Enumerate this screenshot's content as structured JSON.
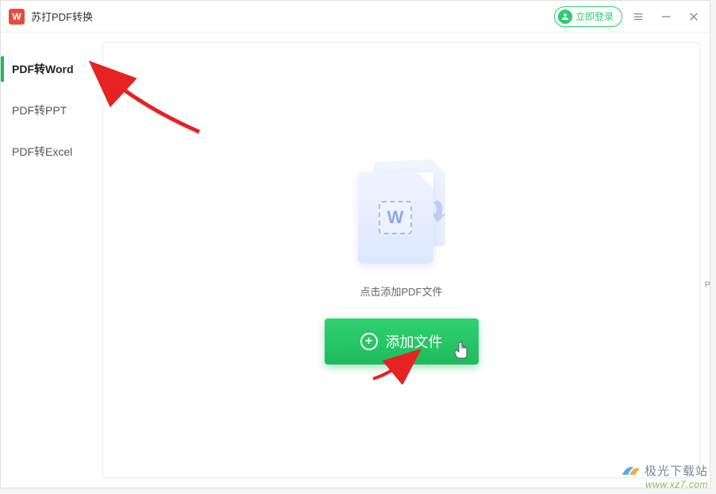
{
  "app": {
    "icon_letter": "W",
    "title": "苏打PDF转换"
  },
  "titlebar": {
    "login_label": "立即登录"
  },
  "sidebar": {
    "items": [
      {
        "label": "PDF转Word",
        "active": true
      },
      {
        "label": "PDF转PPT",
        "active": false
      },
      {
        "label": "PDF转Excel",
        "active": false
      }
    ]
  },
  "main": {
    "doc_letter": "W",
    "hint": "点击添加PDF文件",
    "add_button_label": "添加文件"
  },
  "watermark": {
    "site_name": "极光下载站",
    "site_url": "www.xz7.com"
  },
  "edge_text": "P"
}
